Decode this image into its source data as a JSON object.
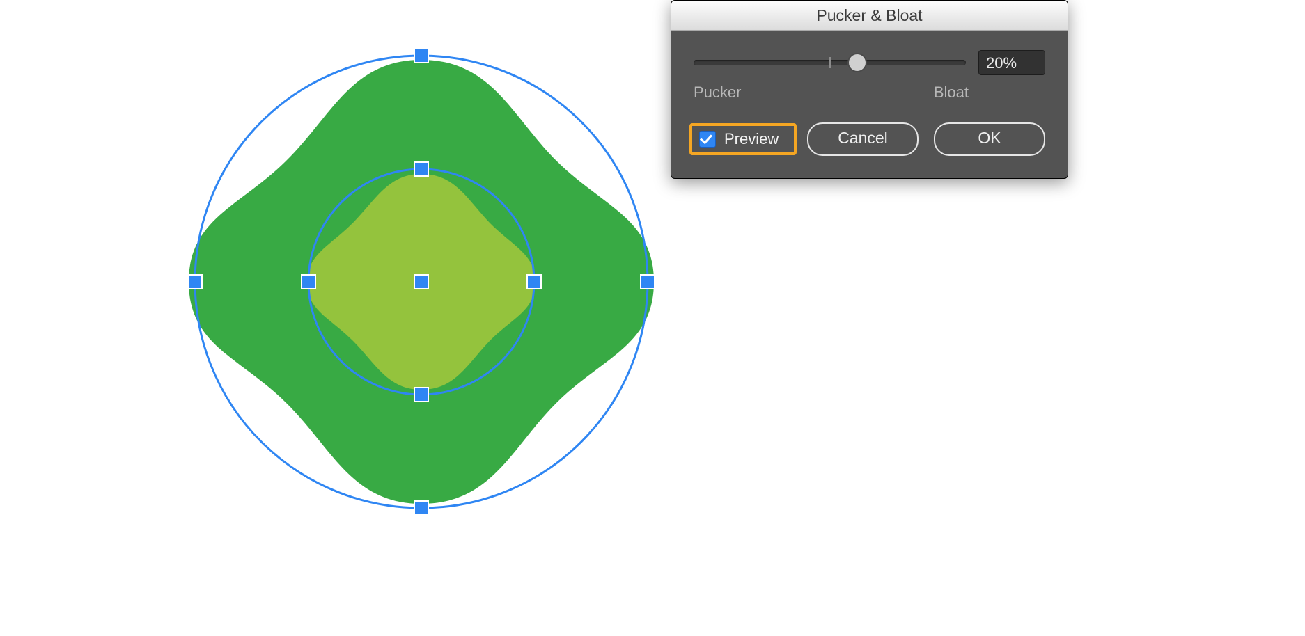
{
  "canvas": {
    "outer_shape_color": "#38aa44",
    "inner_shape_color": "#94c33d",
    "selection_color": "#2f86f3",
    "bloat_percent": 20
  },
  "dialog": {
    "title": "Pucker & Bloat",
    "slider": {
      "left_label": "Pucker",
      "right_label": "Bloat",
      "min": -100,
      "max": 100,
      "value": 20,
      "value_display": "20%"
    },
    "preview": {
      "label": "Preview",
      "checked": true,
      "highlighted": true
    },
    "buttons": {
      "cancel": "Cancel",
      "ok": "OK"
    }
  }
}
